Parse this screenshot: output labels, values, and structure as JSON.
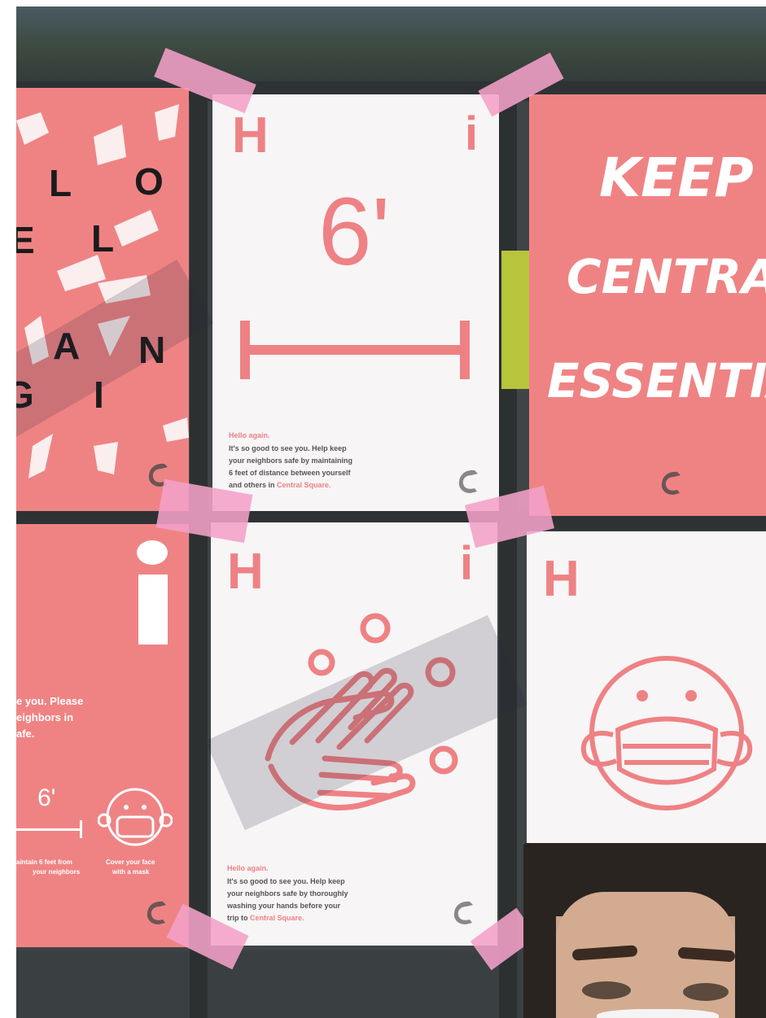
{
  "posters": {
    "hello_mangi_letters": [
      "L",
      "O",
      "E",
      "L",
      "A",
      "N",
      "G",
      "I"
    ],
    "six_feet": {
      "h_letter": "H",
      "i_letter": "i",
      "big_text": "6'",
      "caption_title": "Hello again.",
      "caption_lines": [
        "It's so good to see you. Help keep",
        "your neighbors safe by maintaining",
        "6 feet of distance between yourself",
        "and others in"
      ],
      "caption_highlight": "Central Square."
    },
    "keep_central": {
      "line1": "KEEP",
      "line2": "CENTRAL",
      "line3": "ESSENTIA"
    },
    "partial_left": {
      "i_letter": "i",
      "text_lines": [
        "e you. Please",
        "eighbors in",
        "afe."
      ],
      "six_label": "6'",
      "col1_caption": [
        "aintain 6 feet from",
        "your neighbors"
      ],
      "col2_caption": [
        "Cover your face",
        "with a mask"
      ]
    },
    "hand_wash": {
      "h_letter": "H",
      "i_letter": "i",
      "caption_title": "Hello again.",
      "caption_lines": [
        "It's so good to see you. Help keep",
        "your neighbors safe by thoroughly",
        "washing your hands before your",
        "trip to"
      ],
      "caption_highlight": "Central Square."
    },
    "mask": {
      "h_letter": "H"
    }
  },
  "colors": {
    "poster_pink": "#ef8384",
    "poster_white": "#f7f5f6",
    "tape_pink": "#f4a0c8",
    "frame_dark": "#2e3234"
  }
}
